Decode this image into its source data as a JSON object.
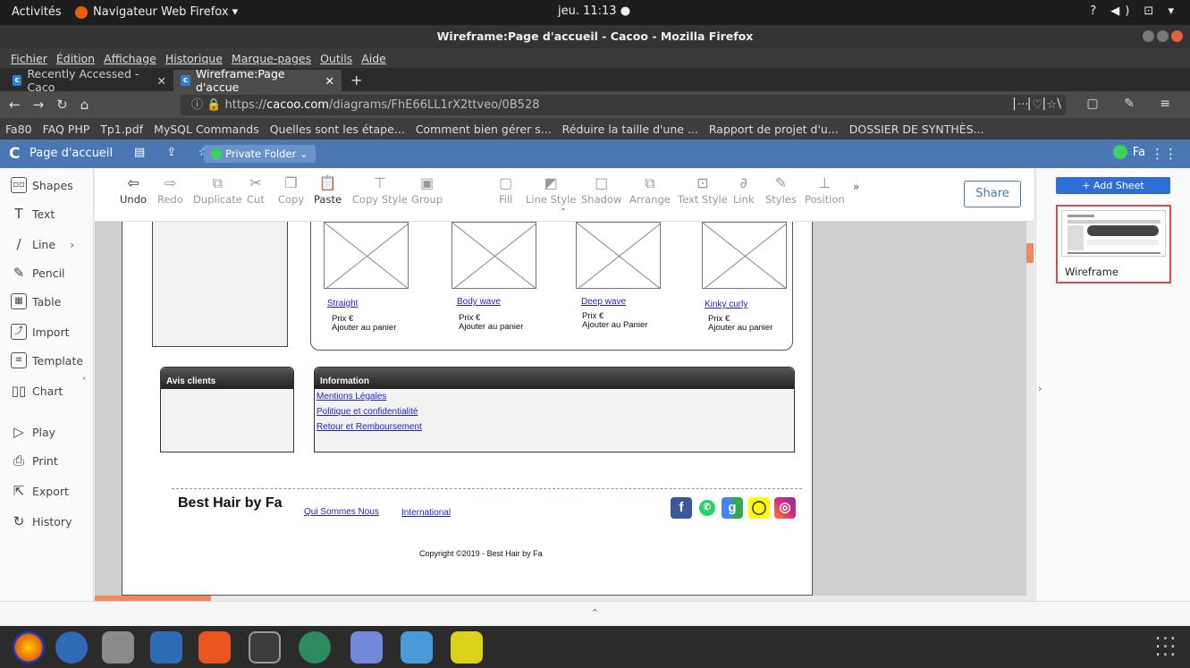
{
  "system": {
    "activities": "Activités",
    "app_name": "Navigateur Web Firefox ▾",
    "clock": "jeu. 11:13 ●",
    "tray": "? ◀) ⊡ ▾"
  },
  "window": {
    "title": "Wireframe:Page d'accueil - Cacoo - Mozilla Firefox"
  },
  "menu": [
    "Fichier",
    "Édition",
    "Affichage",
    "Historique",
    "Marque-pages",
    "Outils",
    "Aide"
  ],
  "tabs": [
    {
      "label": "Recently Accessed - Caco",
      "active": false
    },
    {
      "label": "Wireframe:Page d'accue",
      "active": true
    }
  ],
  "url": {
    "prefix": "https://",
    "host": "cacoo.com",
    "path": "/diagrams/FhE66LL1rX2ttveo/0B528"
  },
  "bookmarks": [
    "Fa80",
    "FAQ PHP",
    "Tp1.pdf",
    "MySQL Commands",
    "Quelles sont les étape...",
    "Comment bien gérer s...",
    "Réduire la taille d'une ...",
    "Rapport de projet d'u...",
    "DOSSIER DE SYNTHÈS..."
  ],
  "cacoo": {
    "page_title": "Page d'accueil",
    "folder": "Private Folder ⌄",
    "user": "Fa",
    "share": "Share",
    "add_sheet": "+ Add Sheet",
    "sheet_name": "Wireframe"
  },
  "left_tools": [
    "Shapes",
    "Text",
    "Line",
    "Pencil",
    "Table",
    "Import",
    "Template",
    "Chart",
    "Play",
    "Print",
    "Export",
    "History"
  ],
  "toolbar": [
    "Undo",
    "Redo",
    "Duplicate",
    "Cut",
    "Copy",
    "Paste",
    "Copy Style",
    "Group",
    "Fill",
    "Line Style",
    "Shadow",
    "Arrange",
    "Text Style",
    "Link",
    "Styles",
    "Position"
  ],
  "wireframe": {
    "products": [
      {
        "name": "Straight",
        "price": "Prix €",
        "action": "Ajouter au panier"
      },
      {
        "name": "Body wave",
        "price": "Prix €",
        "action": "Ajouter au panier"
      },
      {
        "name": "Deep wave",
        "price": "Prix €",
        "action": "Ajouter au Panier"
      },
      {
        "name": "Kinky curly",
        "price": "Prix €",
        "action": "Ajouter au panier"
      }
    ],
    "avis_title": "Avis clients",
    "info_title": "Information",
    "info_links": [
      "Mentions Légales",
      "Politique et confidentialité",
      "Retour et Remboursement"
    ],
    "brand": "Best Hair by Fa",
    "footer_links": [
      "Qui Sommes Nous",
      "International"
    ],
    "copyright": "Copyright ©2019 - Best Hair by Fa"
  }
}
